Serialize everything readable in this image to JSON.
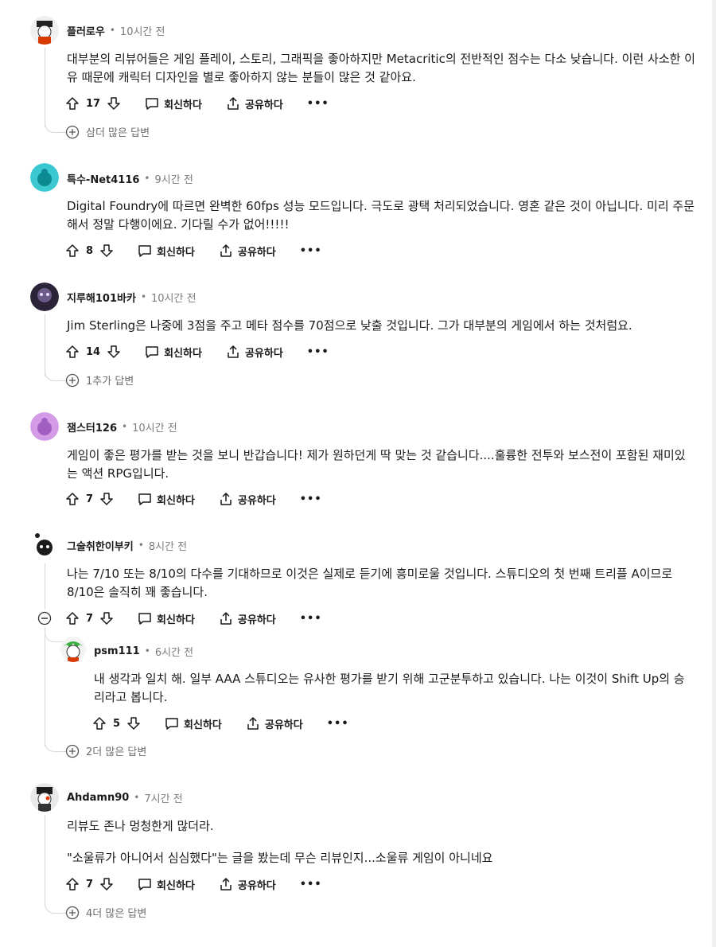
{
  "comments": [
    {
      "author": "플러로우",
      "time": "10시간 전",
      "body": [
        "대부분의 리뷰어들은 게임 플레이, 스토리, 그래픽을 좋아하지만 Metacritic의 전반적인 점수는 다소 낮습니다. 이런 사소한 이유 때문에 캐릭터 디자인을 별로 좋아하지 않는 분들이 많은 것 같아요."
      ],
      "score": "17",
      "reply": "회신하다",
      "share": "공유하다",
      "more": "•••",
      "more_replies": "삼더 많은 답변"
    },
    {
      "author": "특수-Net4116",
      "time": "9시간 전",
      "body": [
        "Digital Foundry에 따르면 완벽한 60fps 성능 모드입니다. 극도로 광택 처리되었습니다. 영혼 같은 것이 아닙니다. 미리 주문해서 정말 다행이에요. 기다릴 수가 없어!!!!!"
      ],
      "score": "8",
      "reply": "회신하다",
      "share": "공유하다",
      "more": "•••"
    },
    {
      "author": "지루해101바카",
      "time": "10시간 전",
      "body": [
        "Jim Sterling은 나중에 3점을 주고 메타 점수를 70점으로 낮출 것입니다. 그가 대부분의 게임에서 하는 것처럼요."
      ],
      "score": "14",
      "reply": "회신하다",
      "share": "공유하다",
      "more": "•••",
      "more_replies": "1추가 답변"
    },
    {
      "author": "잼스터126",
      "time": "10시간 전",
      "body": [
        "게임이 좋은 평가를 받는 것을 보니 반갑습니다! 제가 원하던게 딱 맞는 것 같습니다....훌륭한 전투와 보스전이 포함된 재미있는 액션 RPG입니다."
      ],
      "score": "7",
      "reply": "회신하다",
      "share": "공유하다",
      "more": "•••"
    },
    {
      "author": "그술취한이부키",
      "time": "8시간 전",
      "body": [
        "나는 7/10 또는 8/10의 다수를 기대하므로 이것은 실제로 듣기에 흥미로울 것입니다. 스튜디오의 첫 번째 트리플 A이므로 8/10은 솔직히 꽤 좋습니다."
      ],
      "score": "7",
      "reply": "회신하다",
      "share": "공유하다",
      "more": "•••",
      "more_replies": "2더 많은 답변",
      "replies": [
        {
          "author": "psm111",
          "time": "6시간 전",
          "body": [
            "내 생각과 일치 해. 일부 AAA 스튜디오는 유사한 평가를 받기 위해 고군분투하고 있습니다. 나는 이것이 Shift Up의 승리라고 봅니다."
          ],
          "score": "5",
          "reply": "회신하다",
          "share": "공유하다",
          "more": "•••"
        }
      ]
    },
    {
      "author": "Ahdamn90",
      "time": "7시간 전",
      "body": [
        "리뷰도 존나 멍청한게 많더라.",
        "\"소울류가 아니어서 심심했다\"는 글을 봤는데 무슨 리뷰인지...소울류 게임이 아니네요"
      ],
      "score": "7",
      "reply": "회신하다",
      "share": "공유하다",
      "more": "•••",
      "more_replies": "4더 많은 답변"
    }
  ],
  "colors": {
    "text": "#1a1a1b",
    "meta": "#7c7c7c",
    "thread": "#d7d7d7"
  },
  "icons": {
    "upvote": "arrow-up-icon",
    "downvote": "arrow-down-icon",
    "reply": "speech-bubble-icon",
    "share": "share-icon",
    "expand": "plus-circle-icon",
    "collapse": "minus-circle-icon"
  }
}
